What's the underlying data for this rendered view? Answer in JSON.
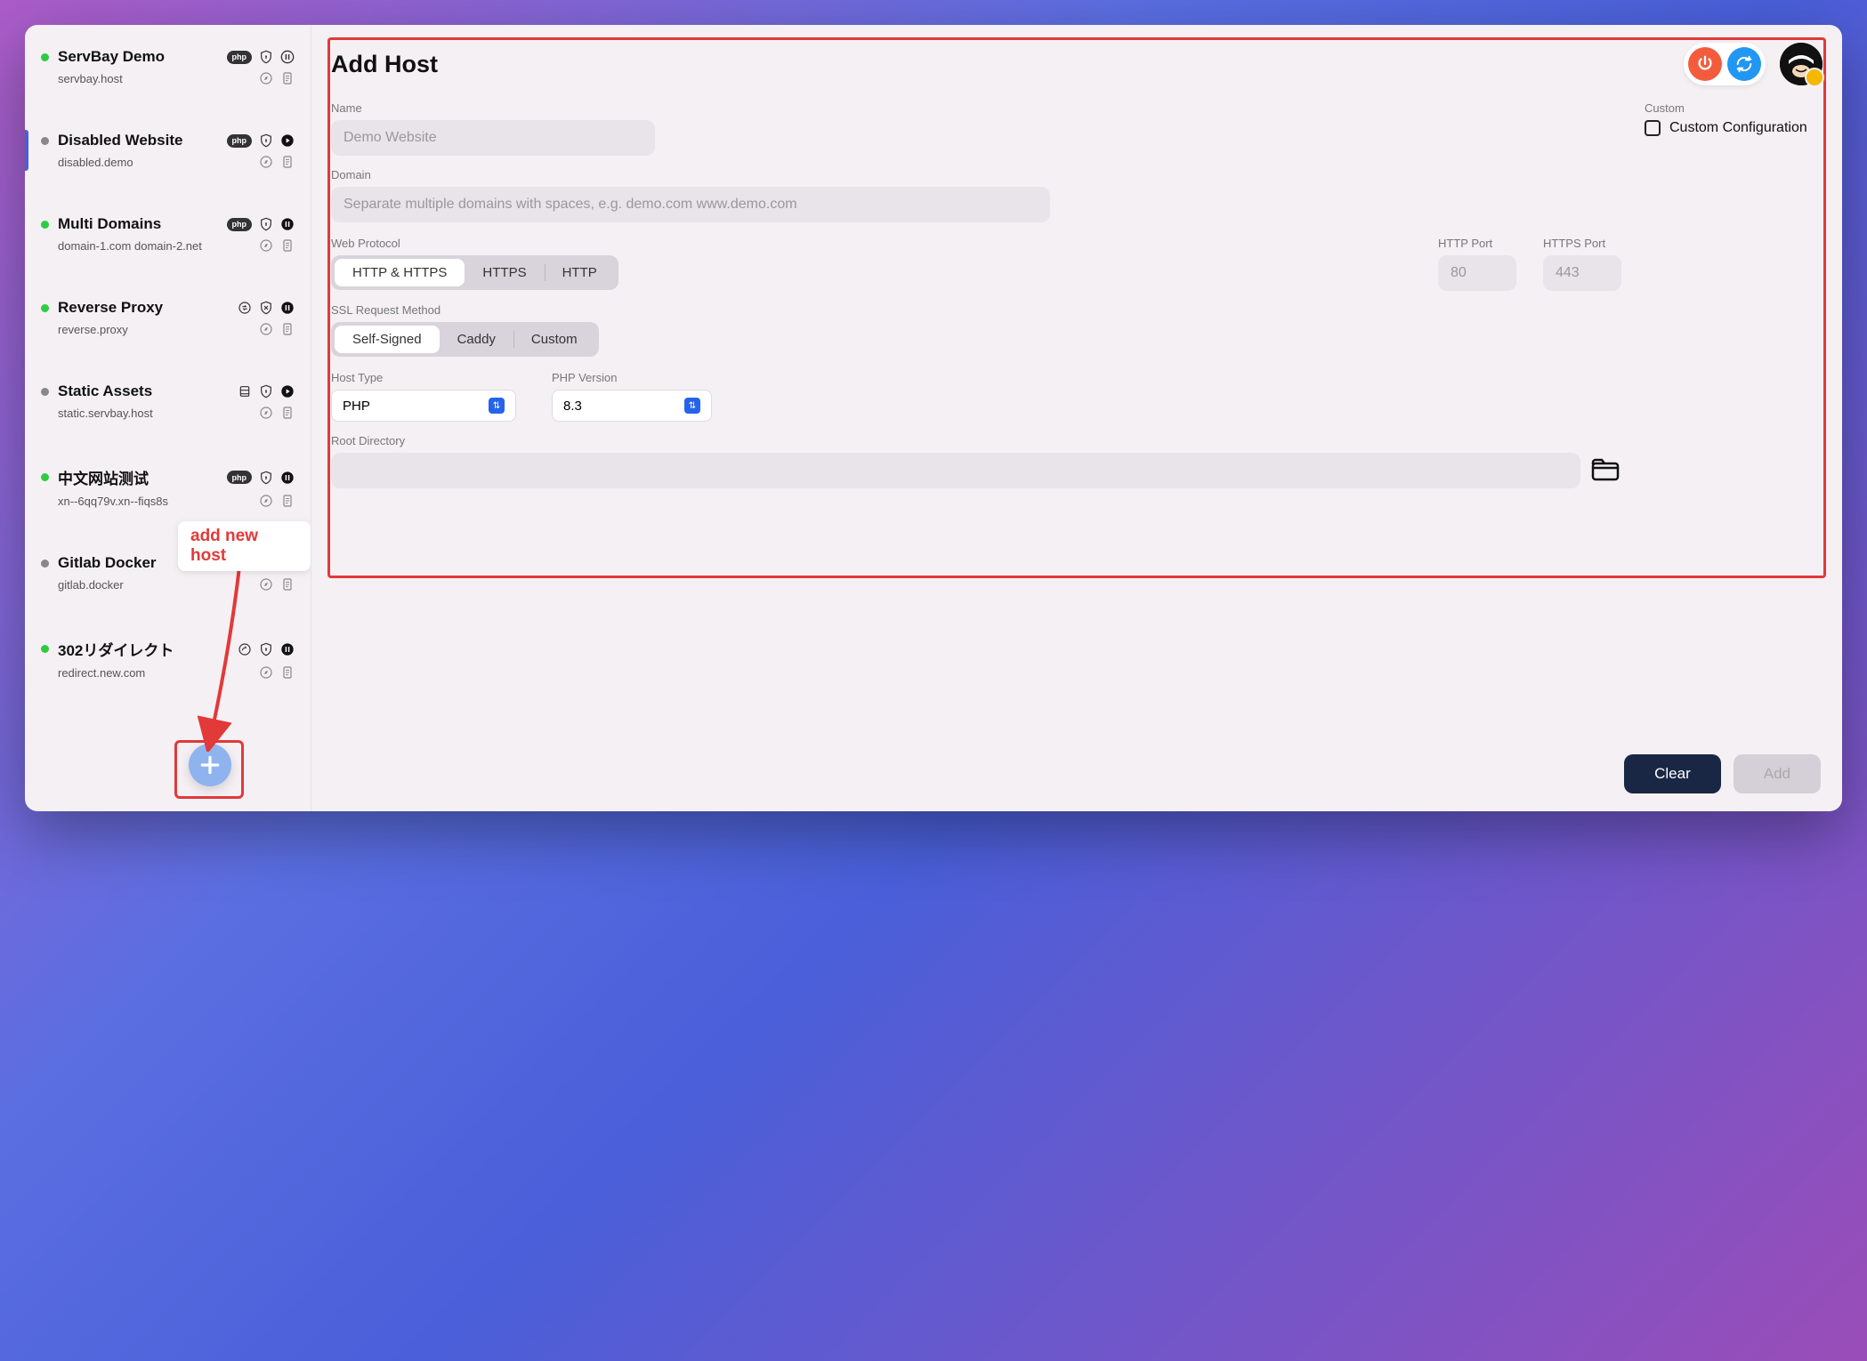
{
  "sidebar": {
    "hosts": [
      {
        "name": "ServBay Demo",
        "domain": "servbay.host",
        "status": "green",
        "type": "php",
        "pause": true
      },
      {
        "name": "Disabled Website",
        "domain": "disabled.demo",
        "status": "gray",
        "type": "php",
        "play": true
      },
      {
        "name": "Multi Domains",
        "domain": "domain-1.com domain-2.net",
        "status": "green",
        "type": "php",
        "pause": true,
        "pausedark": true
      },
      {
        "name": "Reverse Proxy",
        "domain": "reverse.proxy",
        "status": "green",
        "type": "proxy",
        "pause": true,
        "pausedark": true
      },
      {
        "name": "Static Assets",
        "domain": "static.servbay.host",
        "status": "gray",
        "type": "static",
        "play": true
      },
      {
        "name": "中文网站测试",
        "domain": "xn--6qq79v.xn--fiqs8s",
        "status": "green",
        "type": "php",
        "pause": true,
        "pausedark": true
      },
      {
        "name": "Gitlab Docker",
        "domain": "gitlab.docker",
        "status": "gray",
        "type": "proxy",
        "play": true
      },
      {
        "name": "302リダイレクト",
        "domain": "redirect.new.com",
        "status": "green",
        "type": "redirect",
        "pause": true,
        "pausedark": true
      }
    ]
  },
  "annotation": "add new host",
  "header": {
    "title": "Add Host"
  },
  "form": {
    "name_label": "Name",
    "name_placeholder": "Demo Website",
    "custom_label": "Custom",
    "custom_config": "Custom Configuration",
    "domain_label": "Domain",
    "domain_placeholder": "Separate multiple domains with spaces, e.g. demo.com www.demo.com",
    "web_protocol_label": "Web Protocol",
    "protocols": [
      "HTTP & HTTPS",
      "HTTPS",
      "HTTP"
    ],
    "http_port_label": "HTTP Port",
    "http_port_placeholder": "80",
    "https_port_label": "HTTPS Port",
    "https_port_placeholder": "443",
    "ssl_label": "SSL Request Method",
    "ssl_methods": [
      "Self-Signed",
      "Caddy",
      "Custom"
    ],
    "host_type_label": "Host Type",
    "host_type_value": "PHP",
    "php_version_label": "PHP Version",
    "php_version_value": "8.3",
    "root_label": "Root Directory"
  },
  "footer": {
    "clear": "Clear",
    "add": "Add"
  }
}
